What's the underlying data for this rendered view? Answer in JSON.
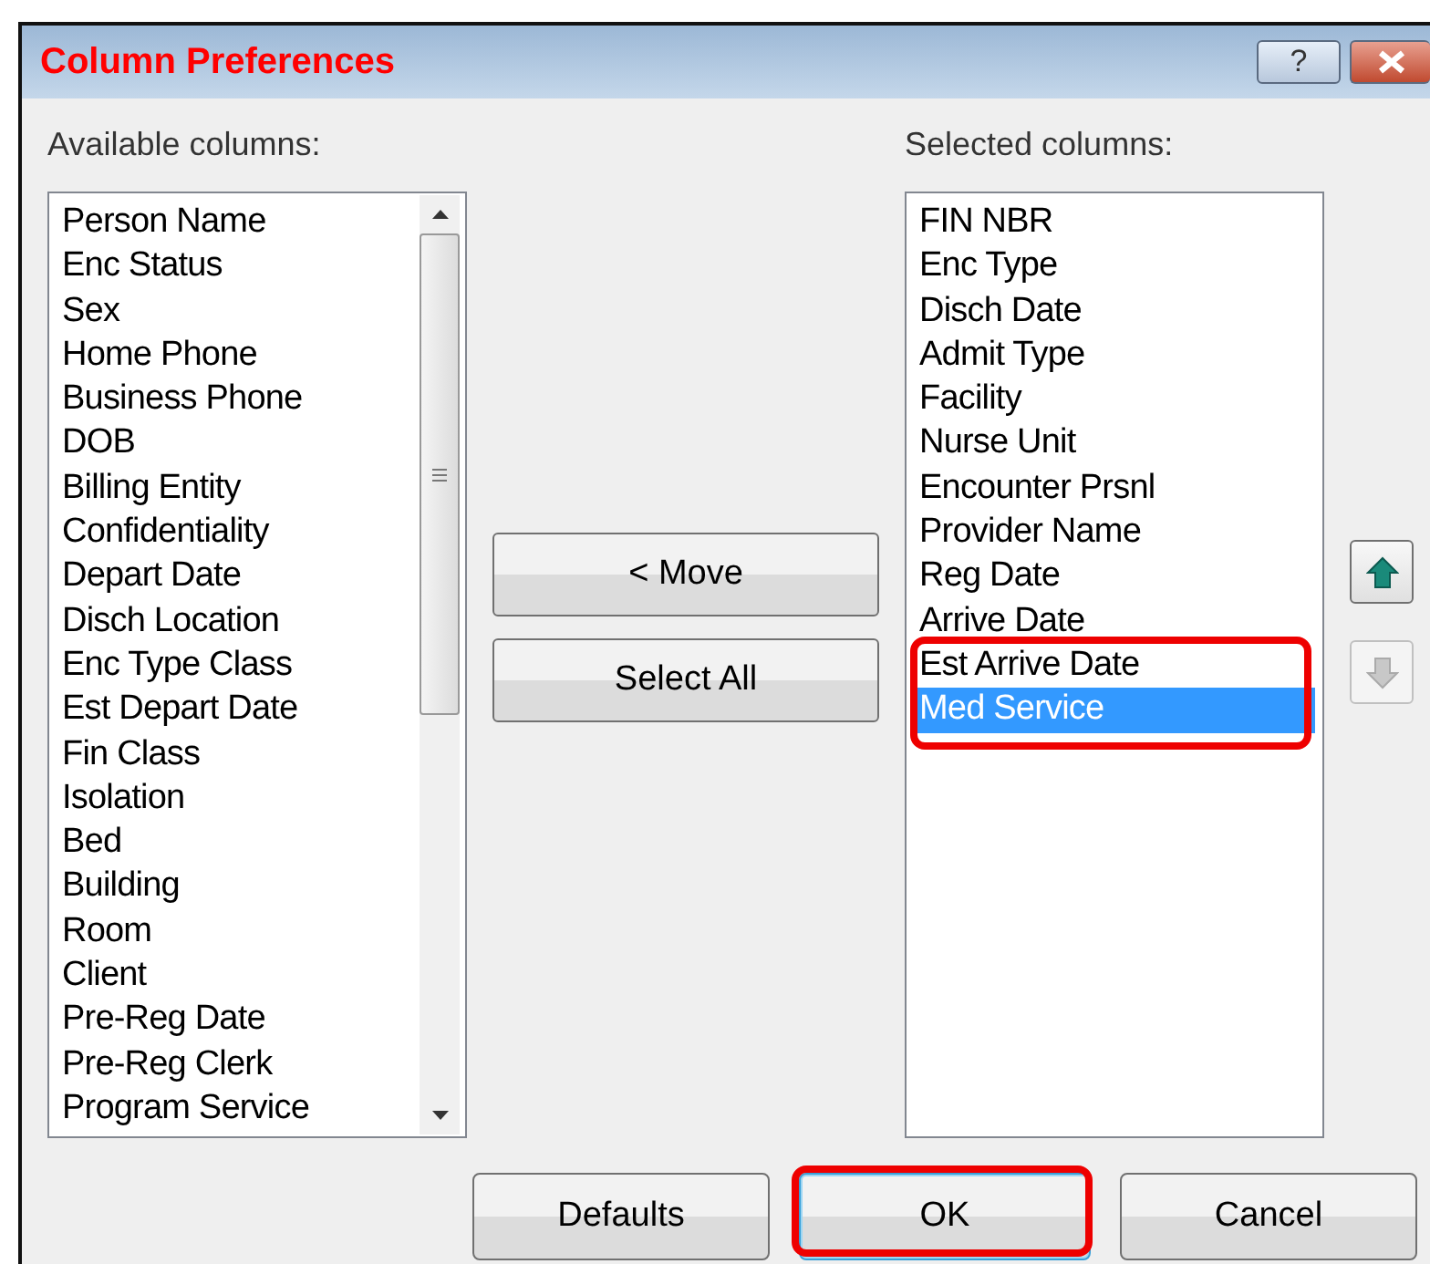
{
  "window": {
    "title": "Column Preferences",
    "help_button": "?"
  },
  "available": {
    "label": "Available columns:",
    "items": [
      {
        "text": "Person Name",
        "selected": false
      },
      {
        "text": "Enc Status",
        "selected": false
      },
      {
        "text": "Sex",
        "selected": false
      },
      {
        "text": "Home Phone",
        "selected": false
      },
      {
        "text": "Business Phone",
        "selected": false
      },
      {
        "text": "DOB",
        "selected": false
      },
      {
        "text": "Billing Entity",
        "selected": false
      },
      {
        "text": "Confidentiality",
        "selected": false
      },
      {
        "text": "Depart Date",
        "selected": false
      },
      {
        "text": "Disch Location",
        "selected": false
      },
      {
        "text": "Enc Type Class",
        "selected": false
      },
      {
        "text": "Est Depart Date",
        "selected": false
      },
      {
        "text": "Fin Class",
        "selected": false
      },
      {
        "text": "Isolation",
        "selected": false
      },
      {
        "text": "Bed",
        "selected": false
      },
      {
        "text": "Building",
        "selected": false
      },
      {
        "text": "Room",
        "selected": false
      },
      {
        "text": "Client",
        "selected": false
      },
      {
        "text": "Pre-Reg Date",
        "selected": false
      },
      {
        "text": "Pre-Reg Clerk",
        "selected": false
      },
      {
        "text": "Program Service",
        "selected": false
      }
    ]
  },
  "middle_buttons": [
    {
      "label": "< Move"
    },
    {
      "label": "Select All"
    }
  ],
  "selected": {
    "label": "Selected columns:",
    "items": [
      {
        "text": "FIN NBR",
        "selected": false,
        "highlighted": false
      },
      {
        "text": "Enc Type",
        "selected": false,
        "highlighted": false
      },
      {
        "text": "Disch Date",
        "selected": false,
        "highlighted": false
      },
      {
        "text": "Admit Type",
        "selected": false,
        "highlighted": false
      },
      {
        "text": "Facility",
        "selected": false,
        "highlighted": false
      },
      {
        "text": "Nurse Unit",
        "selected": false,
        "highlighted": false
      },
      {
        "text": "Encounter Prsnl",
        "selected": false,
        "highlighted": false
      },
      {
        "text": "Provider Name",
        "selected": false,
        "highlighted": false
      },
      {
        "text": "Reg Date",
        "selected": false,
        "highlighted": false
      },
      {
        "text": "Arrive Date",
        "selected": false,
        "highlighted": false
      },
      {
        "text": "Est Arrive Date",
        "selected": false,
        "highlighted": true
      },
      {
        "text": "Med Service",
        "selected": true,
        "highlighted": true
      }
    ]
  },
  "order_buttons": [
    {
      "kind": "up",
      "disabled": false
    },
    {
      "kind": "down",
      "disabled": true
    }
  ],
  "footer_buttons": [
    {
      "label": "Defaults",
      "highlighted": false
    },
    {
      "label": "OK",
      "highlighted": true
    },
    {
      "label": "Cancel",
      "highlighted": false
    }
  ]
}
